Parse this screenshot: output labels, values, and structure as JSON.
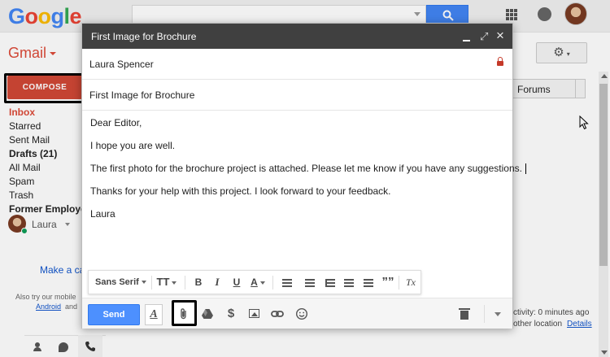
{
  "header": {
    "logo": "Google",
    "search_placeholder": ""
  },
  "app_label": "Gmail",
  "compose_label": "COMPOSE",
  "nav": [
    {
      "label": "Inbox",
      "state": "active"
    },
    {
      "label": "Starred",
      "state": ""
    },
    {
      "label": "Sent Mail",
      "state": ""
    },
    {
      "label": "Drafts (21)",
      "state": "bold"
    },
    {
      "label": "All Mail",
      "state": ""
    },
    {
      "label": "Spam",
      "state": ""
    },
    {
      "label": "Trash",
      "state": ""
    },
    {
      "label": "Former Employe",
      "state": "bold"
    }
  ],
  "hangouts_user": "Laura",
  "make_call": "Make a ca",
  "also_try": "Also try our mobile",
  "android_link": "Android",
  "and_text": "and",
  "tabs": {
    "forums": "Forums"
  },
  "activity": {
    "last_activity": "ctivity: 0 minutes ago",
    "other_location": "other location",
    "details_link": "Details"
  },
  "compose": {
    "title": "First Image for Brochure",
    "to": "Laura Spencer",
    "subject": "First Image for Brochure",
    "body": [
      "Dear Editor,",
      "I hope you are well.",
      "The first photo for the brochure project is attached. Please let me know if you have any suggestions.",
      "Thanks for your help with this project. I look forward to your feedback.",
      "Laura"
    ],
    "send_label": "Send",
    "formatting": {
      "font": "Sans Serif",
      "size_icon": "TT",
      "bold": "B",
      "italic": "I",
      "underline": "U",
      "text_color": "A",
      "quote": "””",
      "clear": "Tx"
    },
    "footer_icons": [
      "formatting-options-icon",
      "attach-icon",
      "drive-icon",
      "money-icon",
      "photo-icon",
      "link-icon",
      "emoji-icon",
      "trash-icon",
      "more-options-icon"
    ]
  },
  "colors": {
    "accent_red": "#dd4b39",
    "compose_red": "#d14836",
    "send_blue": "#4d90fe",
    "title_bar": "#404040"
  }
}
